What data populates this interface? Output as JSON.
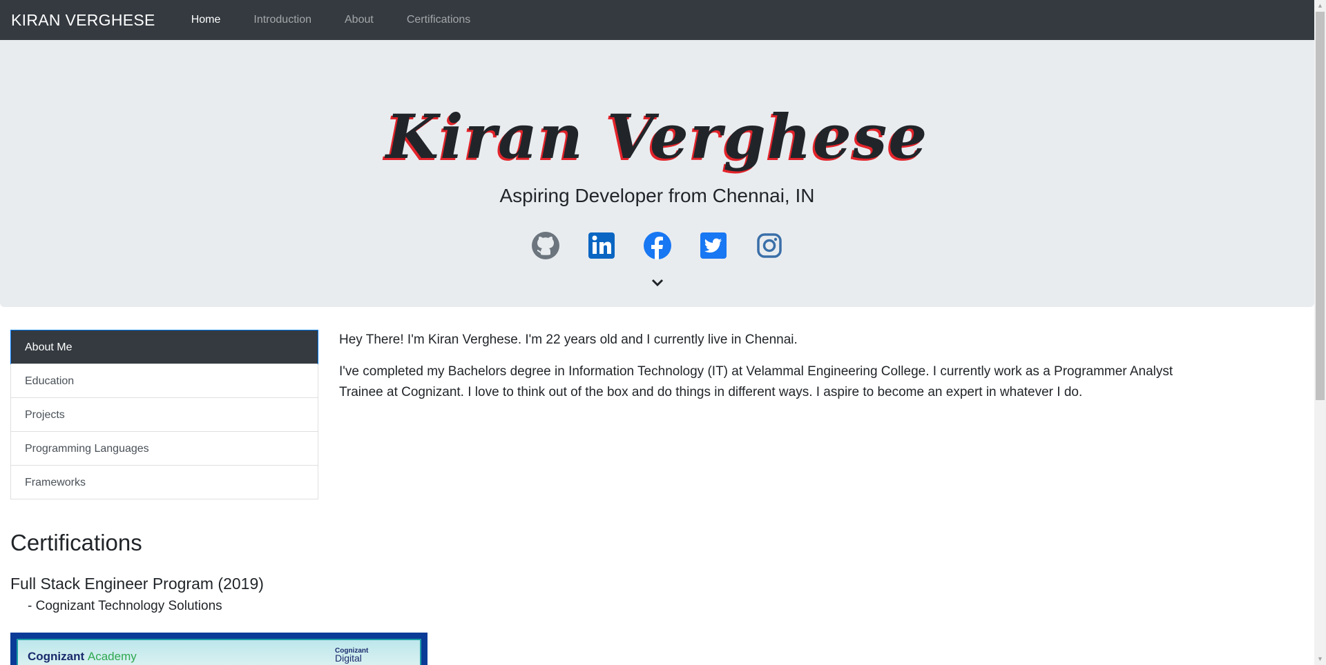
{
  "navbar": {
    "brand": "KIRAN VERGHESE",
    "links": [
      "Home",
      "Introduction",
      "About",
      "Certifications"
    ],
    "active": "Home"
  },
  "hero": {
    "name": "Kiran Verghese",
    "subtitle": "Aspiring Developer from Chennai, IN",
    "socials": [
      "github-icon",
      "linkedin-icon",
      "facebook-icon",
      "twitter-icon",
      "instagram-icon"
    ],
    "scroll_icon": "chevron-down-icon"
  },
  "sidebar": {
    "items": [
      "About Me",
      "Education",
      "Projects",
      "Programming Languages",
      "Frameworks"
    ],
    "active": "About Me"
  },
  "about": {
    "paragraphs": [
      "Hey There! I'm Kiran Verghese. I'm 22 years old and I currently live in Chennai.",
      "I've completed my Bachelors degree in Information Technology (IT) at Velammal Engineering College. I currently work as a Programmer Analyst Trainee at Cognizant. I love to think out of the box and do things in different ways. I aspire to become an expert in whatever I do."
    ]
  },
  "certifications": {
    "heading": "Certifications",
    "items": [
      {
        "title": "Full Stack Engineer Program (2019)",
        "org": "- Cognizant Technology Solutions",
        "image_text": {
          "logo": "Cognizant",
          "logo_suffix": "Academy",
          "right_line1": "Cognizant",
          "right_line2": "Digital"
        }
      }
    ]
  },
  "colors": {
    "navbar_bg": "#343a40",
    "jumbotron_bg": "#e9ecef",
    "accent_shadow": "#e3242b",
    "social_blue": "#0a66c2",
    "github_gray": "#6c757d",
    "active_border": "#007bff"
  }
}
